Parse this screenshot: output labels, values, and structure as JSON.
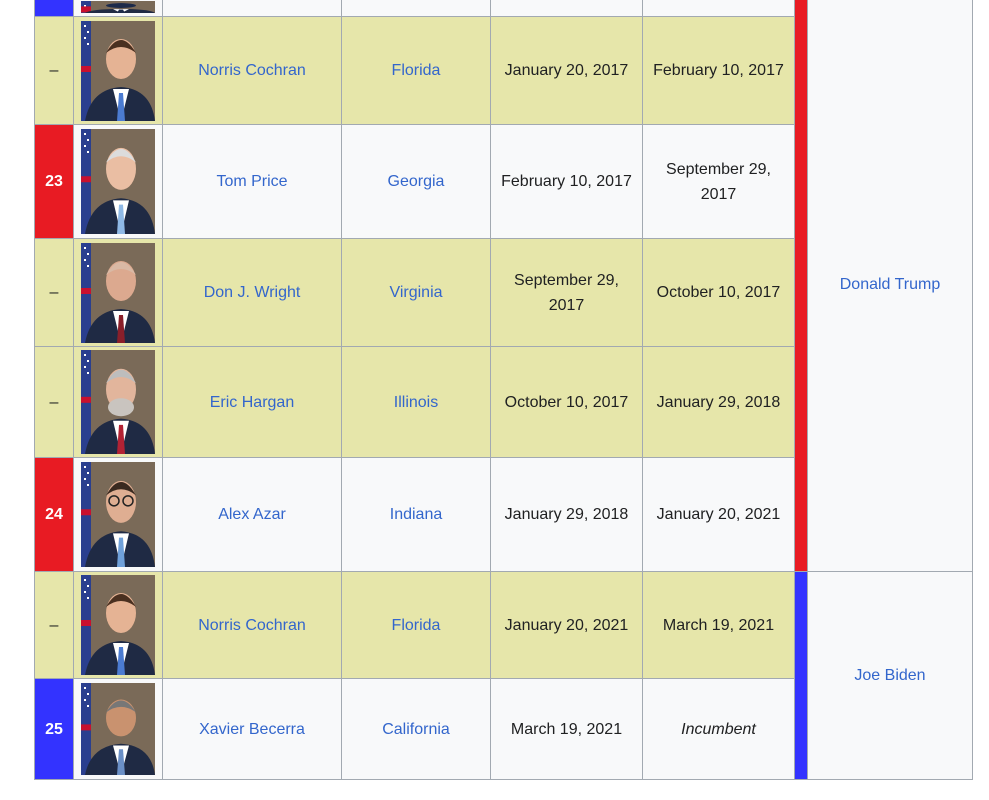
{
  "rows": [
    {
      "number": "",
      "name": "",
      "state": "",
      "start": "",
      "end": "",
      "kind": "regular",
      "numclass": "dem",
      "photo": "suit-dark"
    },
    {
      "number": "–",
      "name": "Norris Cochran",
      "state": "Florida",
      "start": "January 20, 2017",
      "end": "February 10, 2017",
      "kind": "acting",
      "numclass": "act",
      "photo": "young-man"
    },
    {
      "number": "23",
      "name": "Tom Price",
      "state": "Georgia",
      "start": "February 10, 2017",
      "end": "September 29, 2017",
      "kind": "regular",
      "numclass": "rep",
      "photo": "white-hair"
    },
    {
      "number": "–",
      "name": "Don J. Wright",
      "state": "Virginia",
      "start": "September 29, 2017",
      "end": "October 10, 2017",
      "kind": "acting",
      "numclass": "act",
      "photo": "bald-older"
    },
    {
      "number": "–",
      "name": "Eric Hargan",
      "state": "Illinois",
      "start": "October 10, 2017",
      "end": "January 29, 2018",
      "kind": "acting",
      "numclass": "act",
      "photo": "grey-beard"
    },
    {
      "number": "24",
      "name": "Alex Azar",
      "state": "Indiana",
      "start": "January 29, 2018",
      "end": "January 20, 2021",
      "kind": "regular",
      "numclass": "rep",
      "photo": "glasses"
    },
    {
      "number": "–",
      "name": "Norris Cochran",
      "state": "Florida",
      "start": "January 20, 2021",
      "end": "March 19, 2021",
      "kind": "acting",
      "numclass": "act",
      "photo": "young-man"
    },
    {
      "number": "25",
      "name": "Xavier Becerra",
      "state": "California",
      "start": "March 19, 2021",
      "end": "Incumbent",
      "kind": "regular",
      "numclass": "dem",
      "photo": "grey-short"
    }
  ],
  "presidents": [
    {
      "name": "Donald Trump",
      "party": "rep"
    },
    {
      "name": "Joe Biden",
      "party": "dem"
    }
  ],
  "colors": {
    "republican": "#e81b23",
    "democrat": "#3333ff",
    "acting": "#e6e6aa",
    "link": "#3366cc"
  }
}
